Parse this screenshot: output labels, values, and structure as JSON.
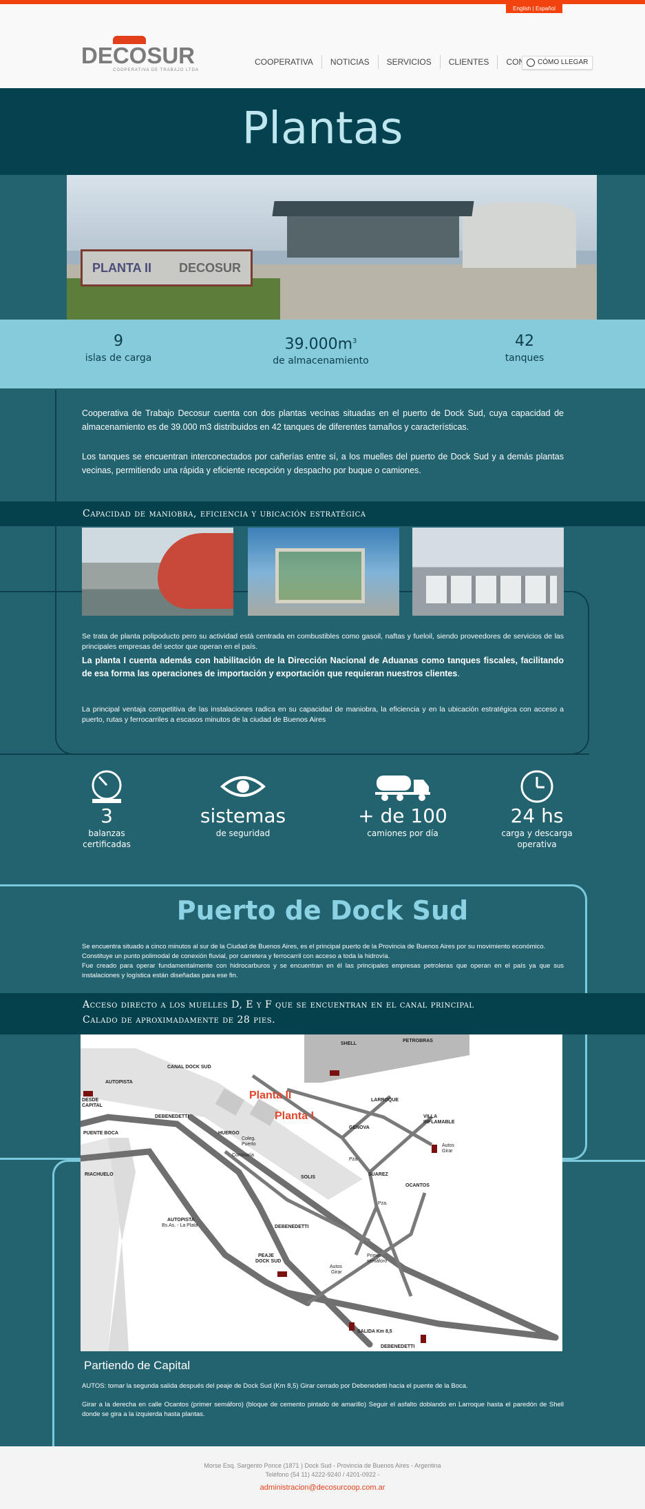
{
  "lang": {
    "english": "English",
    "sep": "|",
    "espanol": "Español"
  },
  "logo": {
    "word": "DECOSUR",
    "tagline": "COOPERATIVA DE TRABAJO LTDA"
  },
  "nav": [
    "COOPERATIVA",
    "NOTICIAS",
    "SERVICIOS",
    "CLIENTES",
    "CONTACTO"
  ],
  "como_llegar": "CÓMO LLEGAR",
  "page_title": "Plantas",
  "hero_sign": {
    "left": "PLANTA II",
    "right": "DECOSUR"
  },
  "stats": [
    {
      "num": "9",
      "label": "islas de carga"
    },
    {
      "num": "39.000m",
      "sup": "3",
      "label": "de almacenamiento"
    },
    {
      "num": "42",
      "label": "tanques"
    }
  ],
  "intro": [
    "Cooperativa de Trabajo Decosur cuenta con dos plantas vecinas situadas en el puerto de Dock Sud, cuya capacidad de almacenamiento es de 39.000 m3 distribuidos en 42 tanques de diferentes tamaños y características.",
    "Los tanques se encuentran interconectados por cañerías entre sí, a los muelles del puerto de Dock Sud y a demás plantas vecinas, permitiendo una rápida y eficiente recepción y despacho por buque o camiones."
  ],
  "capacity_title": "Capacidad de maniobra, eficiencia y ubicación estratégica",
  "planta_text": {
    "p1": "Se trata de planta polipoducto pero su actividad está centrada en combustibles como gasoil, naftas y fueloil, siendo proveedores de servicios de las principales empresas del sector que operan en el país.",
    "p2": "La planta I cuenta además con habilitación de la Dirección Nacional de Aduanas como tanques fiscales, facilitando de esa forma las operaciones de importación y exportación que requieran nuestros clientes",
    "p2_end": ".",
    "p3": "La principal ventaja competitiva de las instalaciones radica en su capacidad de maniobra, la eficiencia y en la ubicación estratégica con acceso a puerto, rutas y ferrocarriles a escasos minutos de la ciudad de Buenos Aires"
  },
  "features": [
    {
      "icon": "scale-icon",
      "big": "3",
      "sub1": "balanzas",
      "sub2": "certificadas"
    },
    {
      "icon": "eye-icon",
      "big": "sistemas",
      "sub1": "de seguridad",
      "sub2": ""
    },
    {
      "icon": "tanker-truck-icon",
      "big": "+ de 100",
      "sub1": "camiones por día",
      "sub2": ""
    },
    {
      "icon": "clock-icon",
      "big": "24 hs",
      "sub1": "carga y descarga",
      "sub2": "operativa"
    }
  ],
  "puerto": {
    "title": "Puerto de Dock Sud",
    "lines": [
      "Se encuentra situado a cinco minutos al sur de la Ciudad de Buenos Aires, es el principal puerto de la Provincia de Buenos Aires por su movimiento económico.",
      "Constituye un punto polimodal de conexión fluvial, por carretera y ferrocarril con acceso a toda la hidrovía.",
      "Fue creado para operar fundamentalmente con hidrocarburos y se encuentran en él las principales empresas petroleras que operan en el país ya que sus instalaciones y logística están diseñadas para ese fin."
    ]
  },
  "acceso": {
    "line1": "Acceso directo a los muelles D, E y F que se encuentran en el canal principal",
    "line2": "Calado de aproximadamente de 28 pies."
  },
  "map_labels": {
    "shell": "SHELL",
    "petrobras": "PETROBRAS",
    "canal": "CANAL DOCK SUD",
    "autopista1": "AUTOPISTA",
    "desde": "DESDE",
    "capital": "CAPITAL",
    "debenedetti": "DEBENEDETTI",
    "puente": "PUENTE BOCA",
    "huergo": "HUERGO",
    "colegio": "Coleg.",
    "puerto": "Puerto",
    "comisaria": "Comisaría",
    "larroque": "LARROQUE",
    "genova": "GENOVA",
    "villa": "VILLA",
    "inflamable": "INFLAMABLE",
    "autos": "Autos",
    "girar": "Girar",
    "solis": "SOLIS",
    "suarez": "SUAREZ",
    "ocantos": "OCANTOS",
    "plaza": "Pza.",
    "riachuelo": "RIACHUELO",
    "autopista2": "AUTOPISTA",
    "bsas": "Bs.As. - La Plata",
    "debenedetti2": "DEBENEDETTI",
    "peaje": "PEAJE",
    "docksud": "DOCK SUD",
    "primer": "Primer",
    "semaforo": "semáforo",
    "autos2": "Autos",
    "girar2": "Girar",
    "salida": "SALIDA Km 8,5",
    "debenedetti3": "DEBENEDETTI",
    "planta2": "Planta II",
    "planta1": "Planta I"
  },
  "partiendo": {
    "title": "Partiendo de Capital",
    "p1": "AUTOS: tomar la segunda salida después del peaje de Dock Sud (Km 8,5) Girar cerrado por Debenedetti hacia el puente de la Boca.",
    "p2": "Girar a la derecha en calle Ocantos (primer semáforo) (bloque de cemento pintado de amarillo) Seguir el asfalto doblando en Larroque hasta el paredón de Shell donde se gira a la izquierda hasta plantas."
  },
  "footer": {
    "addr": "Morse Esq. Sargento Ponce (1871 ) Dock Sud - Provincia de Buenos Aires - Argentina",
    "tel": "Teléfono (54 11) 4222-9240 / 4201-0922 -",
    "mail": "administracion@decosurcoop.com.ar"
  },
  "colors": {
    "accent": "#f2430f",
    "dark": "#04424f",
    "teal": "#23626f",
    "light": "#85cbdc"
  }
}
